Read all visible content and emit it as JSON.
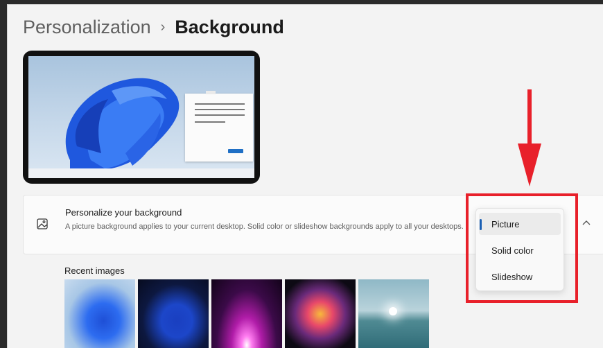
{
  "breadcrumb": {
    "parent": "Personalization",
    "separator": "›",
    "current": "Background"
  },
  "setting": {
    "icon": "picture-icon",
    "title": "Personalize your background",
    "description": "A picture background applies to your current desktop. Solid color or slideshow backgrounds apply to all your desktops."
  },
  "dropdown": {
    "options": [
      "Picture",
      "Solid color",
      "Slideshow"
    ],
    "selected": "Picture"
  },
  "recent": {
    "label": "Recent images"
  },
  "colors": {
    "accent": "#1a5fb4",
    "highlight": "#e8202a"
  }
}
